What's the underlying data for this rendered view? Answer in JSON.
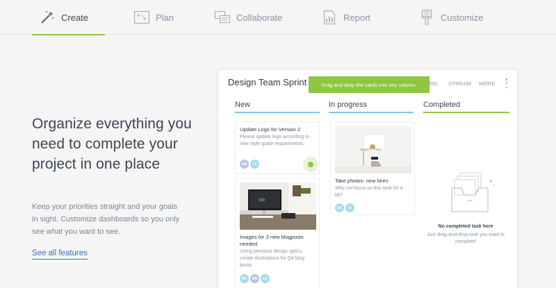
{
  "tabs": [
    {
      "label": "Create",
      "icon": "magic-wand-icon",
      "active": true
    },
    {
      "label": "Plan",
      "icon": "plan-board-icon",
      "active": false
    },
    {
      "label": "Collaborate",
      "icon": "chat-bubbles-icon",
      "active": false
    },
    {
      "label": "Report",
      "icon": "report-chart-icon",
      "active": false
    },
    {
      "label": "Customize",
      "icon": "paint-brush-icon",
      "active": false
    }
  ],
  "hero": {
    "headline": "Organize everything you need to complete your project in one place",
    "subtext": "Keep your priorities straight and your goals in sight. Customize dashboards so you only see what you want to see.",
    "link": "See all features"
  },
  "board": {
    "title": "Design Team Sprint",
    "tab_board_fragment": "RD",
    "tab_stream": "STREAM",
    "tab_more": "MORE",
    "tooltip": "Drag and drop the cards into any column.",
    "columns": [
      {
        "label": "New"
      },
      {
        "label": "In progress"
      },
      {
        "label": "Completed"
      }
    ],
    "cards": {
      "new_1": {
        "title": "Update Logo for Version 2",
        "desc": "Please update logo according to new style guide requirements.",
        "avatars": [
          "MN",
          "LV"
        ]
      },
      "new_2": {
        "title": "Images for 3 new blogposts needed",
        "desc": "Using previous design specs, create illustrations for Q4 blog posts.",
        "avatars": [
          "EK",
          "MN",
          "LV"
        ]
      },
      "progress_1": {
        "title": "Take photos: new hires",
        "desc": "Why not focus on this task for a bit?",
        "avatars": [
          "EK",
          "LV"
        ]
      }
    },
    "empty_state": {
      "title": "No completed task here",
      "subtitle": "Just drag-and-drop task you want to complete!"
    }
  },
  "colors": {
    "accent_green": "#8dc63f",
    "column_blue": "#7ec4e6",
    "link_blue": "#3a6fb5"
  }
}
